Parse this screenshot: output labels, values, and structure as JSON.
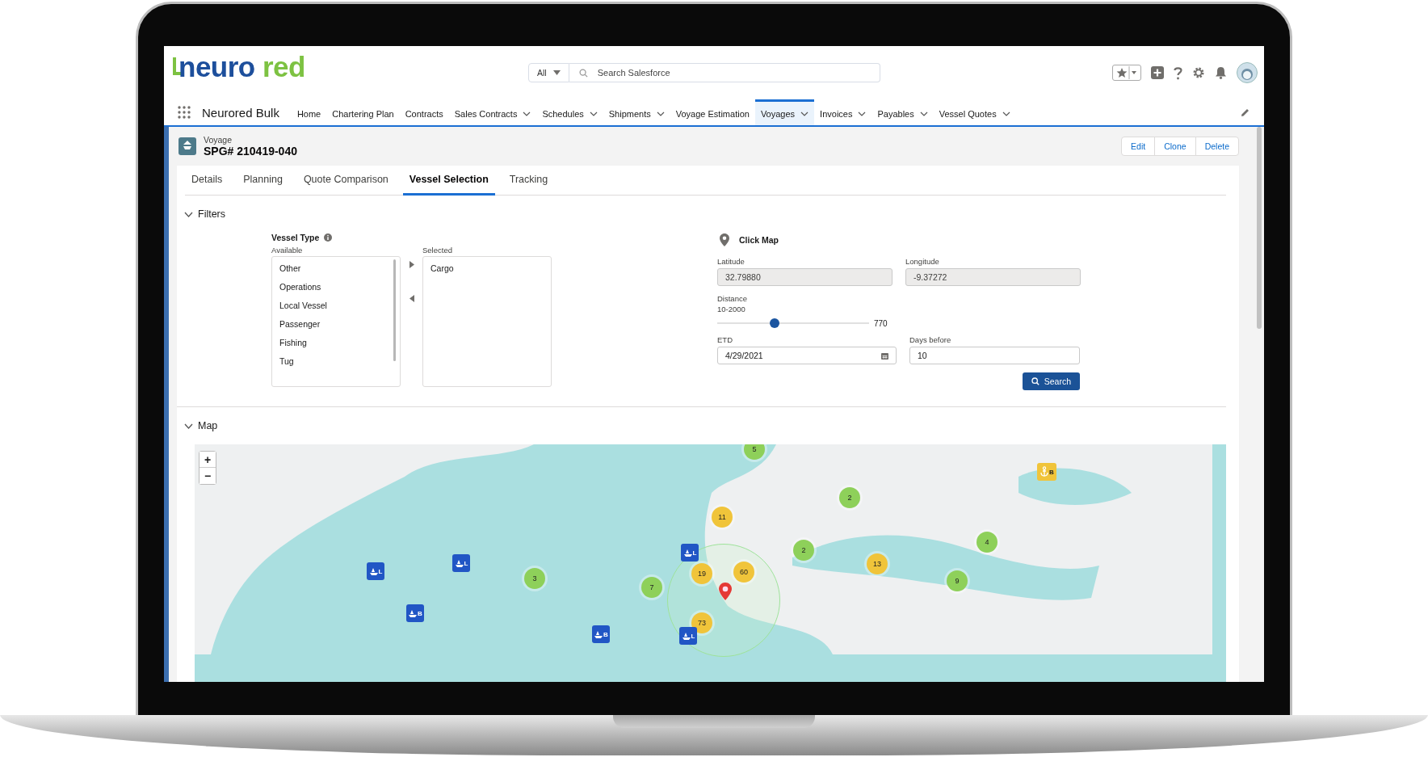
{
  "logo": {
    "part1": "neuro",
    "part2": "red"
  },
  "search": {
    "scope": "All",
    "placeholder": "Search Salesforce"
  },
  "app_name": "Neurored Bulk",
  "nav_items": [
    {
      "label": "Home",
      "menu": false,
      "selected": false
    },
    {
      "label": "Chartering Plan",
      "menu": false,
      "selected": false
    },
    {
      "label": "Contracts",
      "menu": false,
      "selected": false
    },
    {
      "label": "Sales Contracts",
      "menu": true,
      "selected": false
    },
    {
      "label": "Schedules",
      "menu": true,
      "selected": false
    },
    {
      "label": "Shipments",
      "menu": true,
      "selected": false
    },
    {
      "label": "Voyage Estimation",
      "menu": false,
      "selected": false
    },
    {
      "label": "Voyages",
      "menu": true,
      "selected": true
    },
    {
      "label": "Invoices",
      "menu": true,
      "selected": false
    },
    {
      "label": "Payables",
      "menu": true,
      "selected": false
    },
    {
      "label": "Vessel Quotes",
      "menu": true,
      "selected": false
    }
  ],
  "record": {
    "object_type": "Voyage",
    "title": "SPG# 210419-040",
    "actions": [
      "Edit",
      "Clone",
      "Delete"
    ]
  },
  "tabs": [
    {
      "label": "Details",
      "selected": false
    },
    {
      "label": "Planning",
      "selected": false
    },
    {
      "label": "Quote Comparison",
      "selected": false
    },
    {
      "label": "Vessel Selection",
      "selected": true
    },
    {
      "label": "Tracking",
      "selected": false
    }
  ],
  "filters": {
    "heading": "Filters",
    "expanded": true,
    "vessel_type": {
      "label": "Vessel Type",
      "available_label": "Available",
      "available": [
        "Other",
        "Operations",
        "Local Vessel",
        "Passenger",
        "Fishing",
        "Tug"
      ],
      "selected_label": "Selected",
      "selected": [
        "Cargo"
      ]
    },
    "click_map": "Click Map",
    "latitude": {
      "label": "Latitude",
      "value": "32.79880",
      "disabled": true
    },
    "longitude": {
      "label": "Longitude",
      "value": "-9.37272",
      "disabled": true
    },
    "distance": {
      "label": "Distance",
      "range": "10-2000",
      "level": 0.38,
      "reading": "770"
    },
    "etd": {
      "label": "ETD",
      "value": "4/29/2021"
    },
    "days_before": {
      "label": "Days before",
      "value": "10"
    },
    "search_button": "Search"
  },
  "map": {
    "heading": "Map",
    "expanded": true,
    "zoom_in": "+",
    "zoom_out": "−",
    "clusters": [
      {
        "count": "5",
        "color": "#8ed05a"
      },
      {
        "count": "11",
        "color": "#f0c43a"
      },
      {
        "count": "2",
        "color": "#8ed05a"
      },
      {
        "count": "2",
        "color": "#8ed05a"
      },
      {
        "count": "19",
        "color": "#f0c43a"
      },
      {
        "count": "60",
        "color": "#f0c43a"
      },
      {
        "count": "3",
        "color": "#8ed05a"
      },
      {
        "count": "7",
        "color": "#8ed05a"
      },
      {
        "count": "73",
        "color": "#f0c43a"
      },
      {
        "count": "13",
        "color": "#f0c43a"
      },
      {
        "count": "4",
        "color": "#8ed05a"
      },
      {
        "count": "9",
        "color": "#8ed05a"
      }
    ],
    "vessels": [
      {
        "label": "L"
      },
      {
        "label": "L"
      },
      {
        "label": "B"
      },
      {
        "label": "B"
      },
      {
        "label": "L"
      },
      {
        "label": "L"
      }
    ],
    "anchor": {
      "label": "B"
    }
  }
}
